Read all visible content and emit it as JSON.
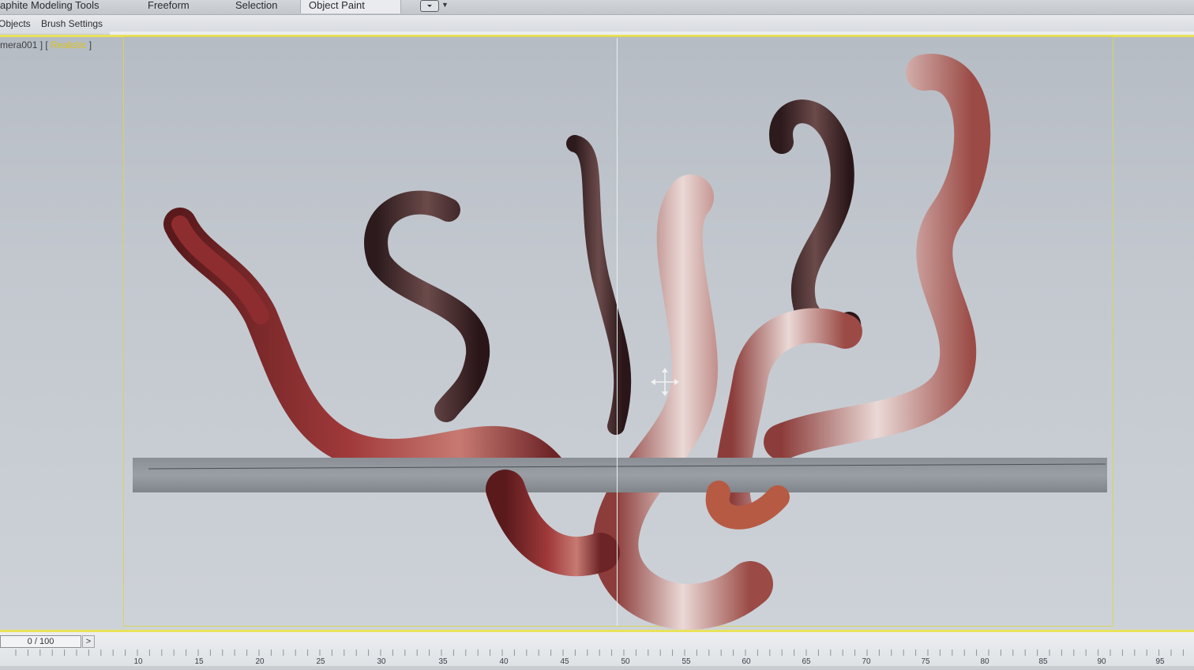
{
  "ribbon": {
    "tabs": [
      {
        "label": "aphite Modeling Tools",
        "active": false
      },
      {
        "label": "Freeform",
        "active": false
      },
      {
        "label": "Selection",
        "active": false
      },
      {
        "label": "Object Paint",
        "active": true
      }
    ],
    "dropdown_icon": "dropdown-square-icon"
  },
  "subribbon": {
    "items": [
      "Objects",
      "Brush Settings"
    ]
  },
  "viewport": {
    "camera_label": "mera001",
    "mode_label": "Realistic",
    "accent_color": "#e9e25a"
  },
  "timeline": {
    "frame_counter": "0 / 100",
    "next_button": ">",
    "ticks": [
      "10",
      "15",
      "20",
      "25",
      "30",
      "35",
      "40",
      "45",
      "50",
      "55",
      "60",
      "65",
      "70",
      "75",
      "80",
      "85",
      "90",
      "95"
    ]
  }
}
